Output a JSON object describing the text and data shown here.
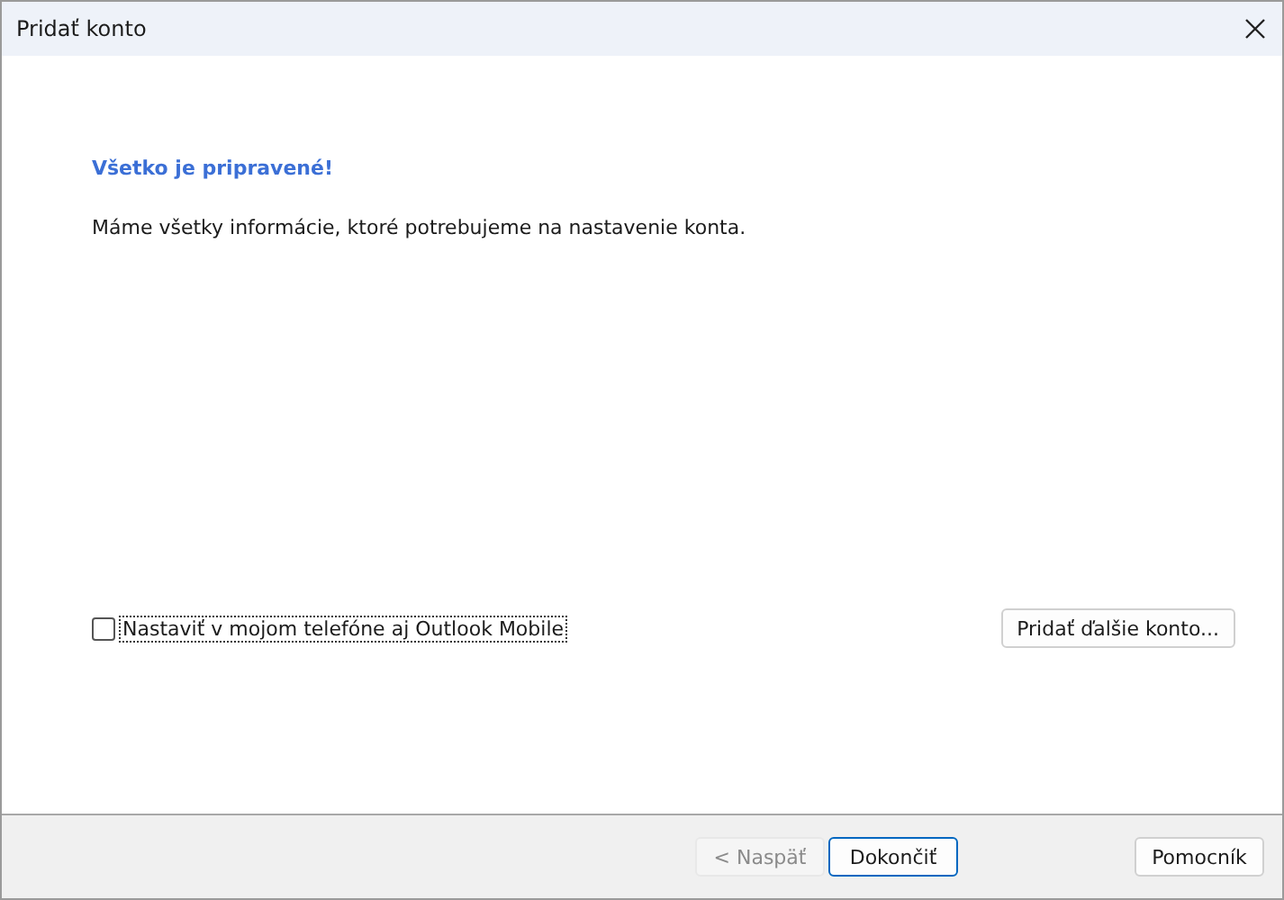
{
  "window": {
    "title": "Pridať konto"
  },
  "heading": "Všetko je pripravené!",
  "message": "Máme všetky informácie, ktoré potrebujeme na nastavenie konta.",
  "mobile_checkbox": {
    "label": "Nastaviť v mojom telefóne aj Outlook Mobile",
    "checked": false
  },
  "add_another_button": "Pridať ďalšie konto...",
  "footer_buttons": [
    {
      "label": "< Naspäť",
      "disabled": true,
      "default": false
    },
    {
      "label": "Dokončiť",
      "disabled": false,
      "default": true
    },
    {
      "label": "Pomocník",
      "disabled": false,
      "default": false
    }
  ]
}
